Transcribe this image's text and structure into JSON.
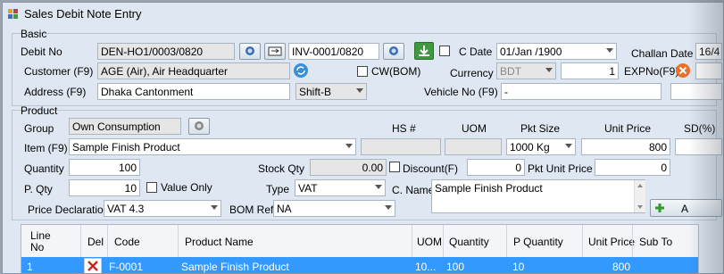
{
  "window": {
    "title": "Sales Debit Note Entry"
  },
  "basic": {
    "group_label": "Basic",
    "debit_no_label": "Debit No",
    "debit_no": "DEN-HO1/0003/0820",
    "invoice_no": "INV-0001/0820",
    "c_date_label": "C Date",
    "c_date": "01/Jan /1900",
    "challan_date_label": "Challan Date",
    "challan_date": "16/4",
    "customer_label": "Customer (F9)",
    "customer": "AGE (Air), Air Headquarter",
    "cw_bom_label": "CW(BOM)",
    "currency_label": "Currency",
    "currency": "BDT",
    "currency_rate": "1",
    "exp_no_label": "EXPNo(F9)",
    "address_label": "Address (F9)",
    "address": "Dhaka Cantonment",
    "shift": "Shift-B",
    "vehicle_no_label": "Vehicle No (F9)",
    "vehicle_no": "-"
  },
  "product": {
    "group_label": "Product",
    "group_field_label": "Group",
    "group_value": "Own Consumption",
    "hs_label": "HS #",
    "uom_label": "UOM",
    "pkt_size_label": "Pkt Size",
    "unit_price_label": "Unit Price",
    "sd_label": "SD(%)",
    "item_label": "Item (F9)",
    "item": "Sample Finish Product",
    "pkt_size": "1000 Kg",
    "unit_price": "800",
    "quantity_label": "Quantity",
    "quantity": "100",
    "stock_qty_label": "Stock Qty",
    "stock_qty": "0.00",
    "discount_label": "Discount(F)",
    "discount": "0",
    "pkt_unit_price_label": "Pkt Unit Price",
    "pkt_unit_price": "0",
    "p_qty_label": "P. Qty",
    "p_qty": "10",
    "value_only_label": "Value Only",
    "type_label": "Type",
    "type": "VAT",
    "c_name_label": "C. Name",
    "c_name": "Sample Finish Product",
    "price_decl_label": "Price Declaration",
    "price_decl": "VAT 4.3",
    "bom_ref_label": "BOM Ref.",
    "bom_ref": "NA",
    "add_label": "A"
  },
  "grid": {
    "headers": {
      "line_no_1": "Line",
      "line_no_2": "No",
      "del": "Del",
      "code": "Code",
      "product_name": "Product Name",
      "uom": "UOM",
      "quantity": "Quantity",
      "p_quantity": "P Quantity",
      "unit_price": "Unit Price",
      "sub_total": "Sub To"
    },
    "rows": [
      {
        "line_no": "1",
        "code": "F-0001",
        "product_name": "Sample Finish Product",
        "uom": "10...",
        "quantity": "100",
        "p_quantity": "10",
        "unit_price": "800"
      }
    ]
  },
  "colors": {
    "selection": "#3399ff",
    "window_bg": "#dfe8f2"
  }
}
